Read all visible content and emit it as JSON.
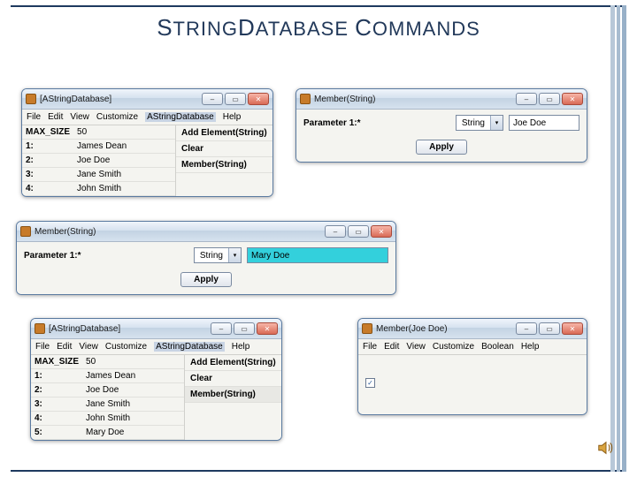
{
  "slide": {
    "title_html": "S|TRING|D|ATABASE |C|OMMANDS"
  },
  "win1": {
    "title": "[AStringDatabase]",
    "menus": [
      "File",
      "Edit",
      "View",
      "Customize",
      "AStringDatabase",
      "Help"
    ],
    "menu_selected_index": 4,
    "maxsize_label": "MAX_SIZE",
    "maxsize_value": "50",
    "rows": [
      {
        "idx": "1:",
        "val": "James Dean"
      },
      {
        "idx": "2:",
        "val": "Joe Doe"
      },
      {
        "idx": "3:",
        "val": "Jane Smith"
      },
      {
        "idx": "4:",
        "val": "John Smith"
      }
    ],
    "cmds": [
      "Add Element(String)",
      "Clear",
      "Member(String)"
    ]
  },
  "win2": {
    "title": "Member(String)",
    "param_label": "Parameter 1:*",
    "type": "String",
    "value": "Joe Doe",
    "apply": "Apply"
  },
  "win3": {
    "title": "Member(String)",
    "param_label": "Parameter 1:*",
    "type": "String",
    "value": "Mary Doe",
    "apply": "Apply"
  },
  "win4": {
    "title": "[AStringDatabase]",
    "menus": [
      "File",
      "Edit",
      "View",
      "Customize",
      "AStringDatabase",
      "Help"
    ],
    "menu_selected_index": 4,
    "maxsize_label": "MAX_SIZE",
    "maxsize_value": "50",
    "rows": [
      {
        "idx": "1:",
        "val": "James Dean"
      },
      {
        "idx": "2:",
        "val": "Joe Doe"
      },
      {
        "idx": "3:",
        "val": "Jane Smith"
      },
      {
        "idx": "4:",
        "val": "John Smith"
      },
      {
        "idx": "5:",
        "val": "Mary Doe"
      }
    ],
    "cmds": [
      "Add Element(String)",
      "Clear",
      "Member(String)"
    ],
    "cmd_highlight_index": 2
  },
  "win5": {
    "title": "Member(Joe Doe)",
    "menus": [
      "File",
      "Edit",
      "View",
      "Customize",
      "Boolean",
      "Help"
    ],
    "checked": true
  },
  "icons": {
    "min": "–",
    "max": "▭",
    "close": "✕",
    "down": "▾",
    "check": "✓"
  }
}
